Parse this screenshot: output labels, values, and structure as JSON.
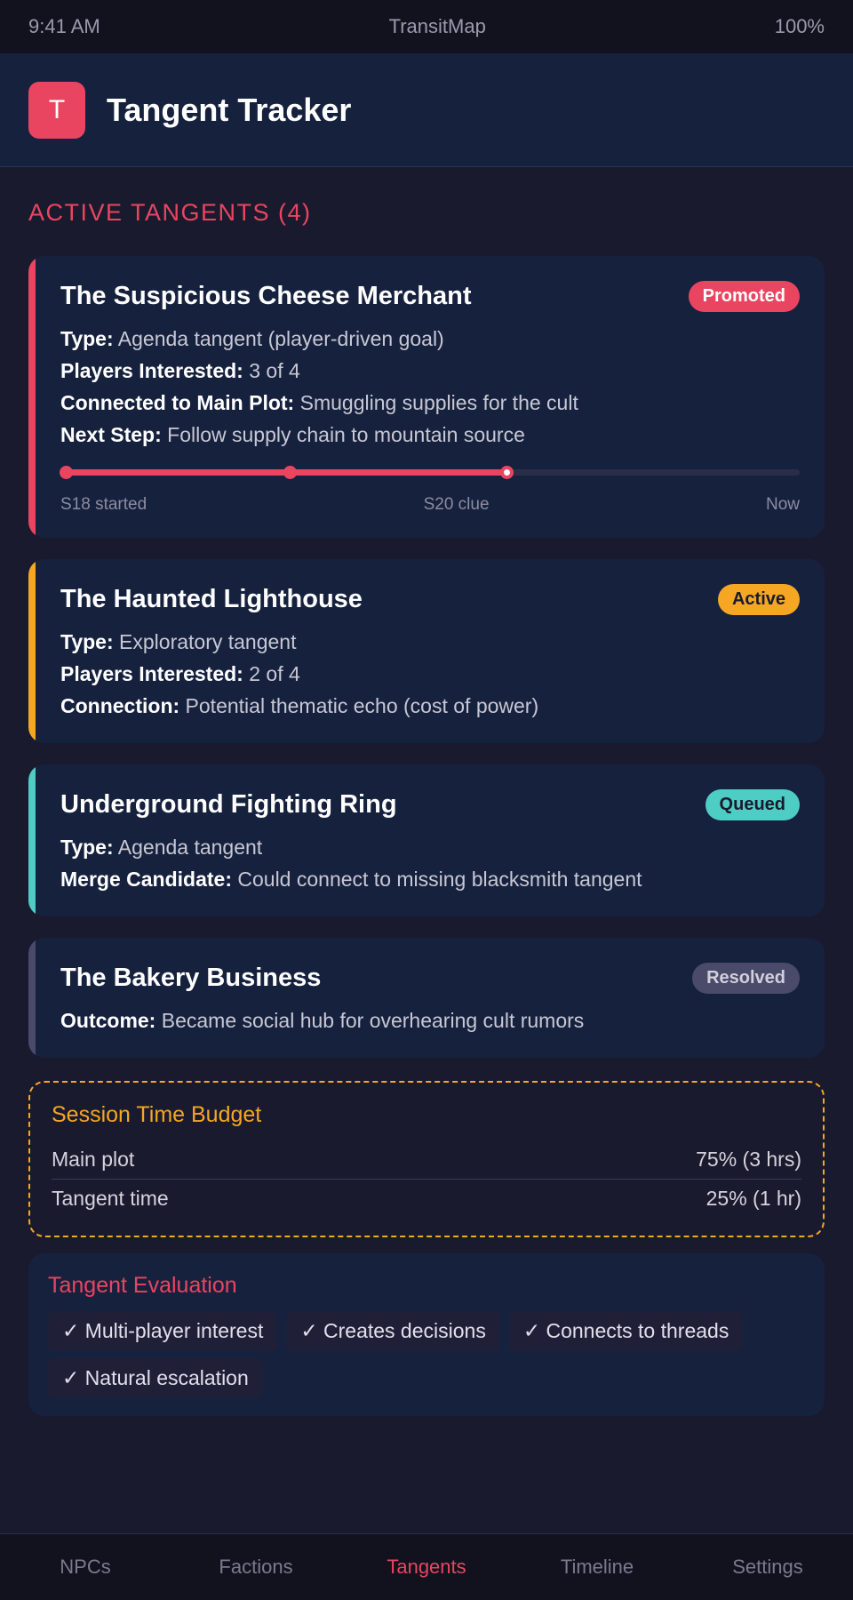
{
  "statusbar": {
    "time": "9:41 AM",
    "app": "TransitMap",
    "battery": "100%"
  },
  "header": {
    "logo_letter": "T",
    "title": "Tangent Tracker"
  },
  "section": {
    "title": "ACTIVE TANGENTS (4)"
  },
  "colors": {
    "promoted": "#e94560",
    "active": "#f5a623",
    "queued": "#4ecdc4",
    "resolved": "#4a4a6a"
  },
  "tangents": [
    {
      "title": "The Suspicious Cheese Merchant",
      "badge": "Promoted",
      "rows": [
        {
          "label": "Type:",
          "value": "Agenda tangent (player-driven goal)"
        },
        {
          "label": "Players Interested:",
          "value": "3 of 4"
        },
        {
          "label": "Connected to Main Plot:",
          "value": "Smuggling supplies for the cult"
        },
        {
          "label": "Next Step:",
          "value": "Follow supply chain to mountain source"
        }
      ],
      "timeline": {
        "progress_pct": 60,
        "labels": [
          "S18 started",
          "S20 clue",
          "Now"
        ]
      }
    },
    {
      "title": "The Haunted Lighthouse",
      "badge": "Active",
      "rows": [
        {
          "label": "Type:",
          "value": "Exploratory tangent"
        },
        {
          "label": "Players Interested:",
          "value": "2 of 4"
        },
        {
          "label": "Connection:",
          "value": "Potential thematic echo (cost of power)"
        }
      ]
    },
    {
      "title": "Underground Fighting Ring",
      "badge": "Queued",
      "rows": [
        {
          "label": "Type:",
          "value": "Agenda tangent"
        },
        {
          "label": "Merge Candidate:",
          "value": "Could connect to missing blacksmith tangent"
        }
      ]
    },
    {
      "title": "The Bakery Business",
      "badge": "Resolved",
      "rows": [
        {
          "label": "Outcome:",
          "value": "Became social hub for overhearing cult rumors"
        }
      ]
    }
  ],
  "budget": {
    "title": "Session Time Budget",
    "rows": [
      {
        "label": "Main plot",
        "value": "75% (3 hrs)"
      },
      {
        "label": "Tangent time",
        "value": "25% (1 hr)"
      }
    ]
  },
  "evaluation": {
    "title": "Tangent Evaluation",
    "chips": [
      "✓ Multi-player interest",
      "✓ Creates decisions",
      "✓ Connects to threads",
      "✓ Natural escalation"
    ]
  },
  "nav": {
    "items": [
      "NPCs",
      "Factions",
      "Tangents",
      "Timeline",
      "Settings"
    ],
    "active": "Tangents"
  }
}
